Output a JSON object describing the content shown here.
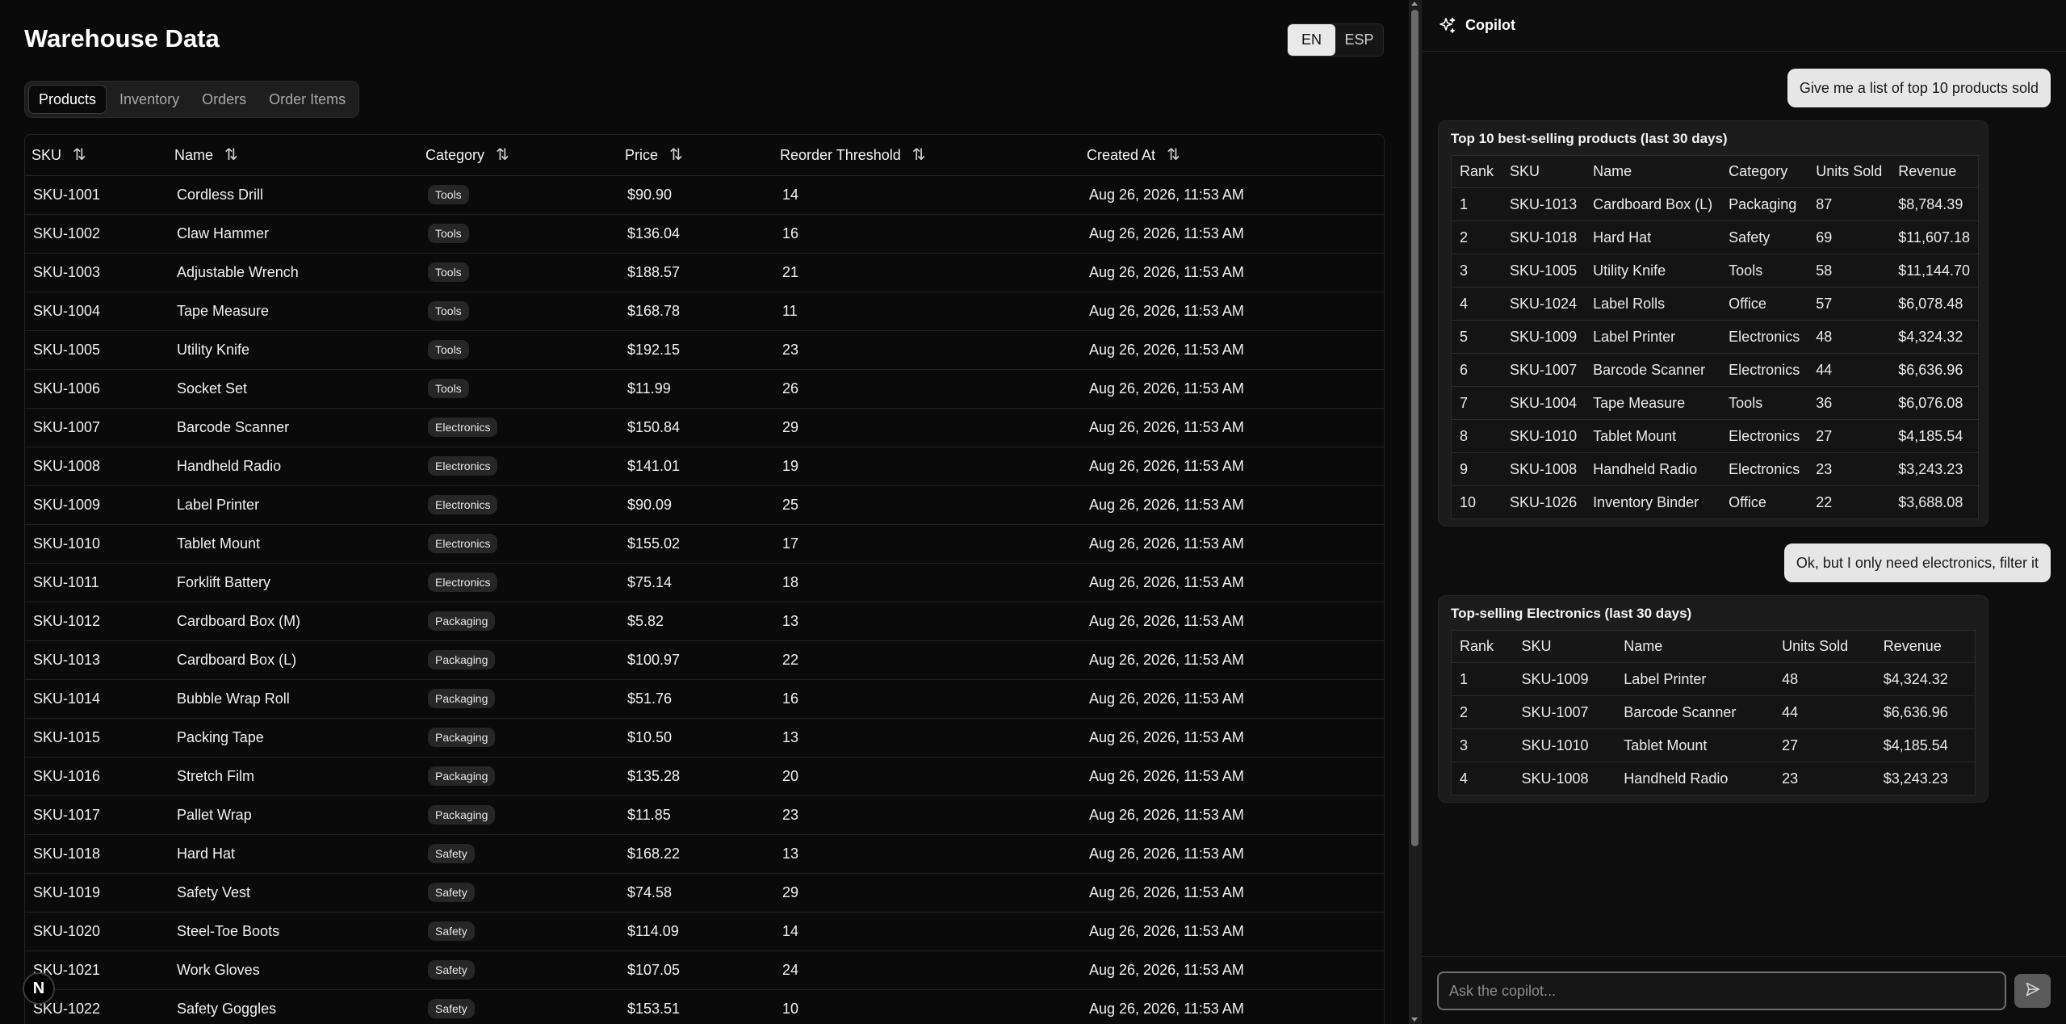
{
  "app": {
    "title": "Warehouse Data",
    "languages": [
      "EN",
      "ESP"
    ],
    "active_language": "EN"
  },
  "tabs": [
    {
      "label": "Products",
      "active": true
    },
    {
      "label": "Inventory",
      "active": false
    },
    {
      "label": "Orders",
      "active": false
    },
    {
      "label": "Order Items",
      "active": false
    }
  ],
  "products_table": {
    "headers": [
      "SKU",
      "Name",
      "Category",
      "Price",
      "Reorder Threshold",
      "Created At"
    ],
    "rows": [
      [
        "SKU-1001",
        "Cordless Drill",
        "Tools",
        "$90.90",
        "14",
        "Aug 26, 2026, 11:53 AM"
      ],
      [
        "SKU-1002",
        "Claw Hammer",
        "Tools",
        "$136.04",
        "16",
        "Aug 26, 2026, 11:53 AM"
      ],
      [
        "SKU-1003",
        "Adjustable Wrench",
        "Tools",
        "$188.57",
        "21",
        "Aug 26, 2026, 11:53 AM"
      ],
      [
        "SKU-1004",
        "Tape Measure",
        "Tools",
        "$168.78",
        "11",
        "Aug 26, 2026, 11:53 AM"
      ],
      [
        "SKU-1005",
        "Utility Knife",
        "Tools",
        "$192.15",
        "23",
        "Aug 26, 2026, 11:53 AM"
      ],
      [
        "SKU-1006",
        "Socket Set",
        "Tools",
        "$11.99",
        "26",
        "Aug 26, 2026, 11:53 AM"
      ],
      [
        "SKU-1007",
        "Barcode Scanner",
        "Electronics",
        "$150.84",
        "29",
        "Aug 26, 2026, 11:53 AM"
      ],
      [
        "SKU-1008",
        "Handheld Radio",
        "Electronics",
        "$141.01",
        "19",
        "Aug 26, 2026, 11:53 AM"
      ],
      [
        "SKU-1009",
        "Label Printer",
        "Electronics",
        "$90.09",
        "25",
        "Aug 26, 2026, 11:53 AM"
      ],
      [
        "SKU-1010",
        "Tablet Mount",
        "Electronics",
        "$155.02",
        "17",
        "Aug 26, 2026, 11:53 AM"
      ],
      [
        "SKU-1011",
        "Forklift Battery",
        "Electronics",
        "$75.14",
        "18",
        "Aug 26, 2026, 11:53 AM"
      ],
      [
        "SKU-1012",
        "Cardboard Box (M)",
        "Packaging",
        "$5.82",
        "13",
        "Aug 26, 2026, 11:53 AM"
      ],
      [
        "SKU-1013",
        "Cardboard Box (L)",
        "Packaging",
        "$100.97",
        "22",
        "Aug 26, 2026, 11:53 AM"
      ],
      [
        "SKU-1014",
        "Bubble Wrap Roll",
        "Packaging",
        "$51.76",
        "16",
        "Aug 26, 2026, 11:53 AM"
      ],
      [
        "SKU-1015",
        "Packing Tape",
        "Packaging",
        "$10.50",
        "13",
        "Aug 26, 2026, 11:53 AM"
      ],
      [
        "SKU-1016",
        "Stretch Film",
        "Packaging",
        "$135.28",
        "20",
        "Aug 26, 2026, 11:53 AM"
      ],
      [
        "SKU-1017",
        "Pallet Wrap",
        "Packaging",
        "$11.85",
        "23",
        "Aug 26, 2026, 11:53 AM"
      ],
      [
        "SKU-1018",
        "Hard Hat",
        "Safety",
        "$168.22",
        "13",
        "Aug 26, 2026, 11:53 AM"
      ],
      [
        "SKU-1019",
        "Safety Vest",
        "Safety",
        "$74.58",
        "29",
        "Aug 26, 2026, 11:53 AM"
      ],
      [
        "SKU-1020",
        "Steel-Toe Boots",
        "Safety",
        "$114.09",
        "14",
        "Aug 26, 2026, 11:53 AM"
      ],
      [
        "SKU-1021",
        "Work Gloves",
        "Safety",
        "$107.05",
        "24",
        "Aug 26, 2026, 11:53 AM"
      ],
      [
        "SKU-1022",
        "Safety Goggles",
        "Safety",
        "$153.51",
        "10",
        "Aug 26, 2026, 11:53 AM"
      ]
    ]
  },
  "logo": {
    "letter": "N"
  },
  "copilot": {
    "title": "Copilot",
    "messages": [
      {
        "role": "user",
        "text": "Give me a list of top 10 products sold"
      },
      {
        "role": "assistant",
        "title": "Top 10 best-selling products (last 30 days)",
        "headers": [
          "Rank",
          "SKU",
          "Name",
          "Category",
          "Units Sold",
          "Revenue"
        ],
        "rows": [
          [
            "1",
            "SKU-1013",
            "Cardboard Box (L)",
            "Packaging",
            "87",
            "$8,784.39"
          ],
          [
            "2",
            "SKU-1018",
            "Hard Hat",
            "Safety",
            "69",
            "$11,607.18"
          ],
          [
            "3",
            "SKU-1005",
            "Utility Knife",
            "Tools",
            "58",
            "$11,144.70"
          ],
          [
            "4",
            "SKU-1024",
            "Label Rolls",
            "Office",
            "57",
            "$6,078.48"
          ],
          [
            "5",
            "SKU-1009",
            "Label Printer",
            "Electronics",
            "48",
            "$4,324.32"
          ],
          [
            "6",
            "SKU-1007",
            "Barcode Scanner",
            "Electronics",
            "44",
            "$6,636.96"
          ],
          [
            "7",
            "SKU-1004",
            "Tape Measure",
            "Tools",
            "36",
            "$6,076.08"
          ],
          [
            "8",
            "SKU-1010",
            "Tablet Mount",
            "Electronics",
            "27",
            "$4,185.54"
          ],
          [
            "9",
            "SKU-1008",
            "Handheld Radio",
            "Electronics",
            "23",
            "$3,243.23"
          ],
          [
            "10",
            "SKU-1026",
            "Inventory Binder",
            "Office",
            "22",
            "$3,688.08"
          ]
        ]
      },
      {
        "role": "user",
        "text": "Ok, but I only need electronics, filter it"
      },
      {
        "role": "assistant",
        "title": "Top-selling Electronics (last 30 days)",
        "headers": [
          "Rank",
          "SKU",
          "Name",
          "Units Sold",
          "Revenue"
        ],
        "rows": [
          [
            "1",
            "SKU-1009",
            "Label Printer",
            "48",
            "$4,324.32"
          ],
          [
            "2",
            "SKU-1007",
            "Barcode Scanner",
            "44",
            "$6,636.96"
          ],
          [
            "3",
            "SKU-1010",
            "Tablet Mount",
            "27",
            "$4,185.54"
          ],
          [
            "4",
            "SKU-1008",
            "Handheld Radio",
            "23",
            "$3,243.23"
          ]
        ]
      }
    ],
    "input_placeholder": "Ask the copilot..."
  },
  "icons": {
    "sort": "sort-icon",
    "sparkle": "sparkle-icon",
    "send": "send-icon",
    "logo": "next-logo"
  },
  "colors": {
    "background": "#0a0a0a",
    "panel": "#1c1c1c",
    "user_bubble": "#e6e6e6",
    "badge": "#262626"
  }
}
